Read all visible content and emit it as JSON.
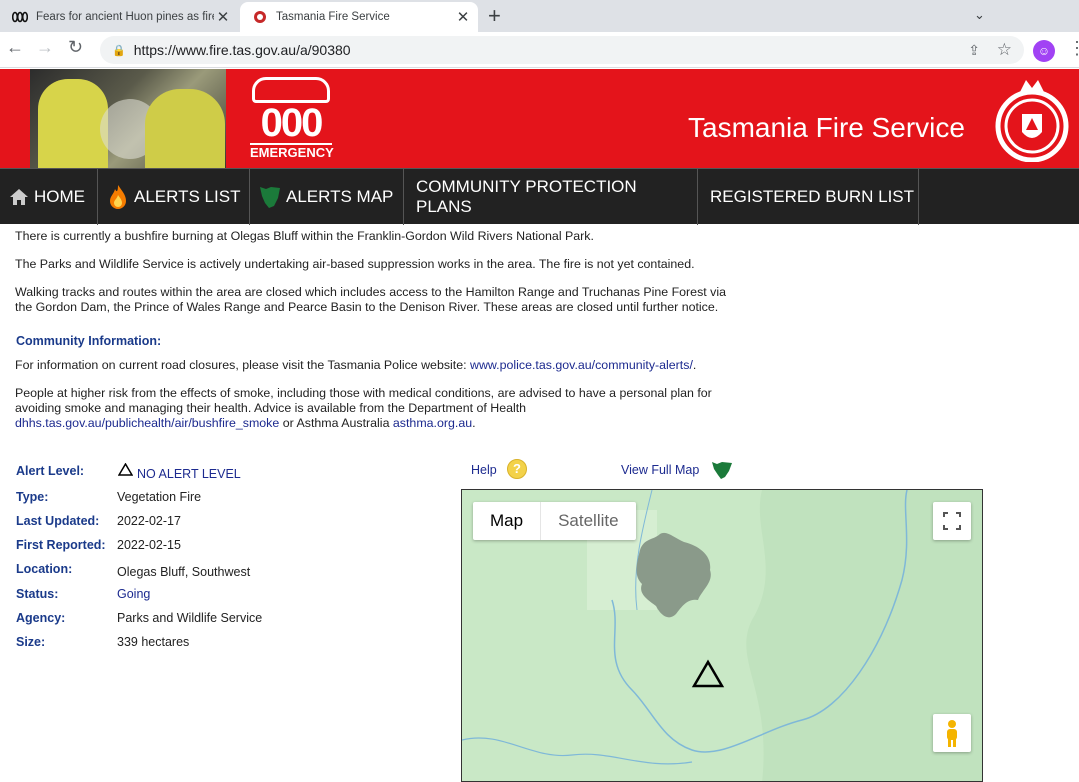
{
  "browser": {
    "tabs": [
      {
        "title": "Fears for ancient Huon pines as fire",
        "favicon": "abc-news-icon",
        "active": false
      },
      {
        "title": "Tasmania Fire Service",
        "favicon": "tfs-crest-icon",
        "active": true
      }
    ],
    "url": "https://www.fire.tas.gov.au/a/90380"
  },
  "header": {
    "emergency_number": "000",
    "emergency_label": "EMERGENCY",
    "site_title": "Tasmania Fire Service"
  },
  "nav": [
    {
      "label": "HOME",
      "icon": "home-icon"
    },
    {
      "label": "ALERTS LIST",
      "icon": "flame-icon"
    },
    {
      "label": "ALERTS MAP",
      "icon": "tasmania-map-icon"
    },
    {
      "label": "COMMUNITY PROTECTION PLANS"
    },
    {
      "label": "REGISTERED BURN LIST"
    }
  ],
  "body": {
    "p1": "There is currently a bushfire burning at Olegas Bluff within the Franklin-Gordon Wild Rivers National Park.",
    "p2": "The Parks and Wildlife Service is actively undertaking air-based suppression works in the area. The fire is not yet contained.",
    "p3a": "Walking tracks and routes within the area are closed which includes access to the Hamilton Range and Truchanas Pine Forest via",
    "p3b": "the Gordon Dam, the Prince of Wales Range and Pearce Basin to the Denison River. These areas are closed until further notice.",
    "community_heading": "Community Information:",
    "p4_text": "For information on current road closures, please visit the Tasmania Police website: ",
    "p4_link": "www.police.tas.gov.au/community-alerts/",
    "p4_end": ".",
    "p5a": "People at higher risk from the effects of smoke, including those with medical conditions, are advised to have a personal plan for",
    "p5b": "avoiding smoke and managing their health. Advice is available from the Department of Health",
    "p5_link1": "dhhs.tas.gov.au/publichealth/air/bushfire_smoke",
    "p5_mid": " or Asthma Australia ",
    "p5_link2": "asthma.org.au",
    "p5_end": "."
  },
  "details": {
    "alert_level_label": "Alert Level:",
    "alert_level_value": "NO ALERT LEVEL",
    "type_label": "Type:",
    "type_value": "Vegetation Fire",
    "last_updated_label": "Last Updated:",
    "last_updated_value": "2022-02-17",
    "first_reported_label": "First Reported:",
    "first_reported_value": "2022-02-15",
    "location_label": "Location:",
    "location_value": "Olegas Bluff, Southwest",
    "status_label": "Status:",
    "status_value": "Going",
    "agency_label": "Agency:",
    "agency_value": "Parks and Wildlife Service",
    "size_label": "Size:",
    "size_value": "339 hectares"
  },
  "map": {
    "help_label": "Help",
    "view_full_map_label": "View Full Map",
    "map_type_map": "Map",
    "map_type_satellite": "Satellite"
  },
  "colors": {
    "brand_red": "#e4141b",
    "nav_bg": "#222222",
    "label_blue": "#1a3a8a"
  }
}
